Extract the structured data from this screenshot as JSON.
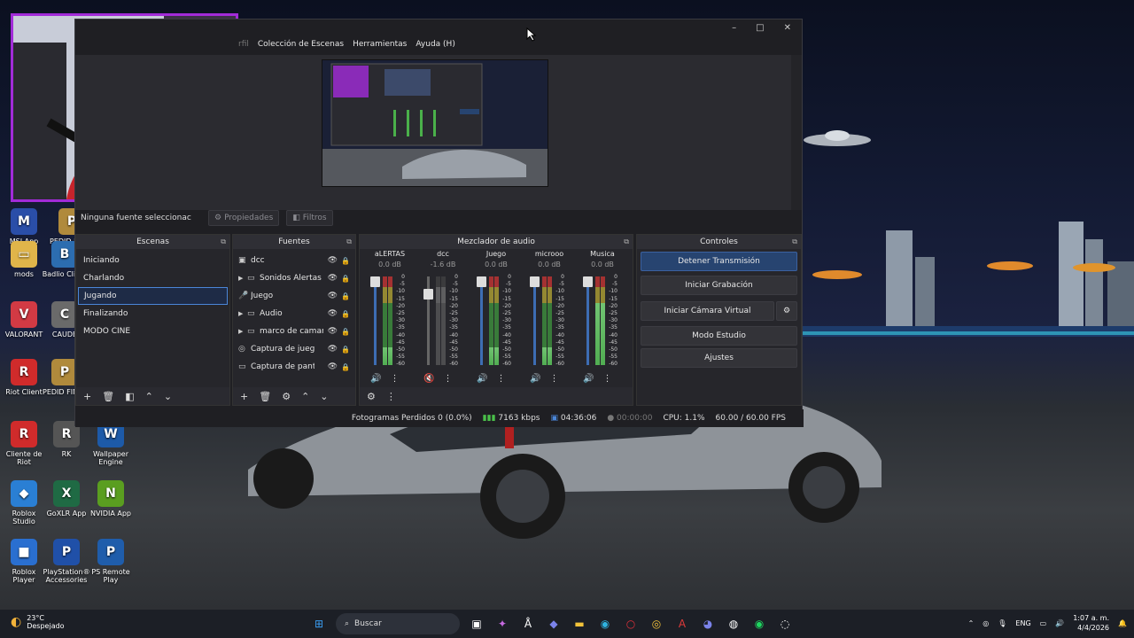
{
  "desktop": {
    "icons": [
      {
        "label": "MSI App Player",
        "glyph": "M",
        "color": "#2a4ea8"
      },
      {
        "label": "PEDID FINAL",
        "glyph": "P",
        "color": "#b08a3c"
      },
      {
        "label": "mods",
        "glyph": "▭",
        "color": "#e0b54a"
      },
      {
        "label": "Badlio Client",
        "glyph": "B",
        "color": "#2c6db0"
      },
      {
        "label": "VALORANT",
        "glyph": "V",
        "color": "#d23a44"
      },
      {
        "label": "CAUDE",
        "glyph": "C",
        "color": "#6a6a6a"
      },
      {
        "label": "Riot Client",
        "glyph": "R",
        "color": "#d02b2b"
      },
      {
        "label": "PEDID FINAL",
        "glyph": "P",
        "color": "#b08a3c"
      },
      {
        "label": "Cliente de Riot",
        "glyph": "R",
        "color": "#d02b2b"
      },
      {
        "label": "RK",
        "glyph": "R",
        "color": "#555"
      },
      {
        "label": "Wallpaper Engine",
        "glyph": "W",
        "color": "#1d5aa8"
      },
      {
        "label": "Roblox Studio",
        "glyph": "◆",
        "color": "#2a7fd4"
      },
      {
        "label": "GoXLR App",
        "glyph": "X",
        "color": "#1f6a44"
      },
      {
        "label": "NVIDIA App",
        "glyph": "N",
        "color": "#5a9e20"
      },
      {
        "label": "Roblox Player",
        "glyph": "■",
        "color": "#2a6fd0"
      },
      {
        "label": "PlayStation® Accessories",
        "glyph": "P",
        "color": "#2050a8"
      },
      {
        "label": "PS Remote Play",
        "glyph": "P",
        "color": "#1f5dab"
      }
    ]
  },
  "obs": {
    "window_controls": {
      "minimize": "–",
      "maximize": "□",
      "close": "✕"
    },
    "menu": [
      "rfil",
      "Colección de Escenas",
      "Herramientas",
      "Ayuda (H)"
    ],
    "source_bar": {
      "none_selected": "Ninguna fuente seleccionac",
      "properties": "Propiedades",
      "filters": "Filtros"
    },
    "scenes": {
      "title": "Escenas",
      "items": [
        "Iniciando",
        "Charlando",
        "Jugando",
        "Finalizando",
        "MODO CINE"
      ],
      "selected": 2
    },
    "sources": {
      "title": "Fuentes",
      "items": [
        {
          "name": "dcc",
          "icon": "▣",
          "expandable": false
        },
        {
          "name": "Sonidos Alertas",
          "icon": "▭",
          "expandable": true
        },
        {
          "name": "Juego",
          "icon": "🎤",
          "expandable": false
        },
        {
          "name": "Audio",
          "icon": "▭",
          "expandable": true
        },
        {
          "name": "marco de camar",
          "icon": "▭",
          "expandable": true
        },
        {
          "name": "Captura de juego",
          "icon": "◎",
          "expandable": false
        },
        {
          "name": "Captura de pantalla",
          "icon": "▭",
          "expandable": false
        }
      ]
    },
    "mixer": {
      "title": "Mezclador de audio",
      "scale": [
        "0",
        "-5",
        "-10",
        "-15",
        "-20",
        "-25",
        "-30",
        "-35",
        "-40",
        "-45",
        "-50",
        "-55",
        "-60"
      ],
      "channels": [
        {
          "name": "aLERTAS",
          "db": "0.0 dB",
          "level": 0.2,
          "fader": 1.0,
          "muted": false
        },
        {
          "name": "dcc",
          "db": "-1.6 dB",
          "level": 0.0,
          "fader": 0.85,
          "muted": true
        },
        {
          "name": "Juego",
          "db": "0.0 dB",
          "level": 0.2,
          "fader": 1.0,
          "muted": false
        },
        {
          "name": "microoo",
          "db": "0.0 dB",
          "level": 0.2,
          "fader": 1.0,
          "muted": false
        },
        {
          "name": "Musica",
          "db": "0.0 dB",
          "level": 0.7,
          "fader": 1.0,
          "muted": false
        }
      ]
    },
    "controls": {
      "title": "Controles",
      "stop_stream": "Detener Transmisión",
      "start_recording": "Iniciar Grabación",
      "virtual_cam": "Iniciar Cámara Virtual",
      "studio_mode": "Modo Estudio",
      "settings": "Ajustes"
    },
    "status": {
      "dropped_frames": "Fotogramas Perdidos 0 (0.0%)",
      "bitrate": "7163 kbps",
      "live_time": "04:36:06",
      "rec_time": "00:00:00",
      "cpu": "CPU: 1.1%",
      "fps": "60.00 / 60.00 FPS"
    }
  },
  "taskbar": {
    "weather_temp": "23°C",
    "weather_desc": "Despejado",
    "search_placeholder": "Buscar",
    "language": "ENG",
    "time": "1:07 a. m.",
    "date": "4/4/2026"
  }
}
